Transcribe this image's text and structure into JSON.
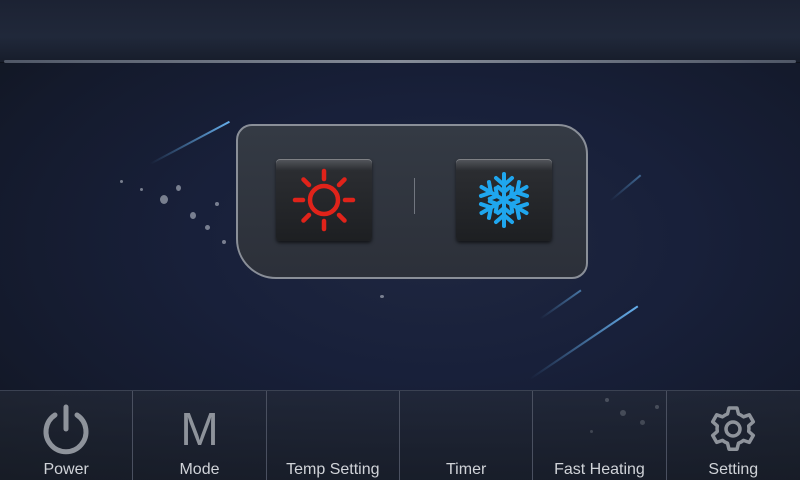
{
  "mode_panel": {
    "heat": {
      "icon": "sun-icon",
      "color": "#e0231a"
    },
    "cool": {
      "icon": "snowflake-icon",
      "color": "#1fa6ee"
    }
  },
  "nav": {
    "power": {
      "label": "Power",
      "icon": "power-icon"
    },
    "mode": {
      "label": "Mode",
      "glyph": "M"
    },
    "temp_setting": {
      "label": "Temp Setting"
    },
    "timer": {
      "label": "Timer"
    },
    "fast_heating": {
      "label": "Fast Heating"
    },
    "setting": {
      "label": "Setting",
      "icon": "gear-icon"
    }
  },
  "colors": {
    "icon_gray": "#8e939b",
    "accent_streak": "#6ebeff"
  }
}
